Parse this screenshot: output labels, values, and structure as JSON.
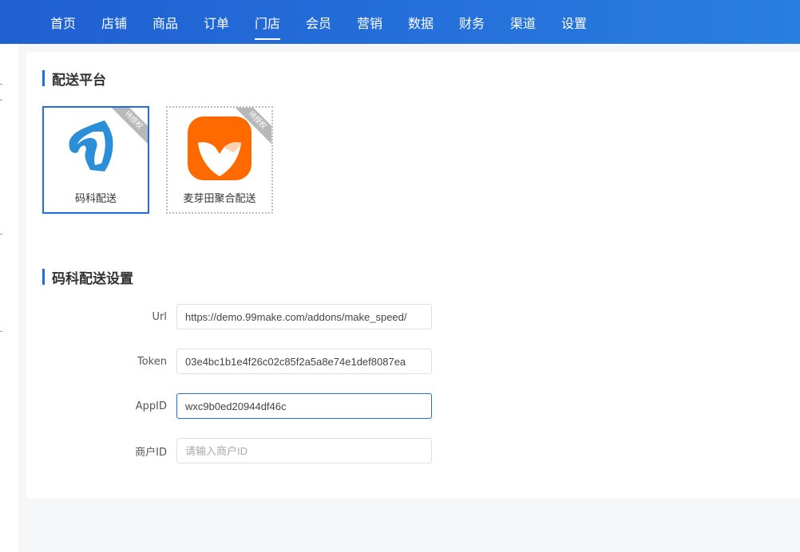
{
  "nav": {
    "items": [
      {
        "label": "首页"
      },
      {
        "label": "店铺"
      },
      {
        "label": "商品"
      },
      {
        "label": "订单"
      },
      {
        "label": "门店"
      },
      {
        "label": "会员"
      },
      {
        "label": "营销"
      },
      {
        "label": "数据"
      },
      {
        "label": "财务"
      },
      {
        "label": "渠道"
      },
      {
        "label": "设置"
      }
    ],
    "active": "门店"
  },
  "delivery_platform": {
    "title": "配送平台",
    "platforms": [
      {
        "name": "码科配送",
        "badge": "待授权",
        "icon": "horse-logo-icon",
        "selected": true
      },
      {
        "name": "麦芽田聚合配送",
        "badge": "待授权",
        "icon": "maiyatian-logo-icon",
        "selected": false
      }
    ]
  },
  "settings": {
    "title": "码科配送设置",
    "fields": {
      "url": {
        "label": "Url",
        "value": "https://demo.99make.com/addons/make_speed/"
      },
      "token": {
        "label": "Token",
        "value": "03e4bc1b1e4f26c02c85f2a5a8e74e1def8087ea"
      },
      "appid": {
        "label": "AppID",
        "value": "wxc9b0ed20944df46c"
      },
      "merchant_id": {
        "label": "商户ID",
        "value": "",
        "placeholder": "请输入商户ID"
      }
    }
  },
  "colors": {
    "accent": "#1f6fe0",
    "brand_orange": "#ff6a00",
    "logo_blue": "#2a8fd6"
  }
}
